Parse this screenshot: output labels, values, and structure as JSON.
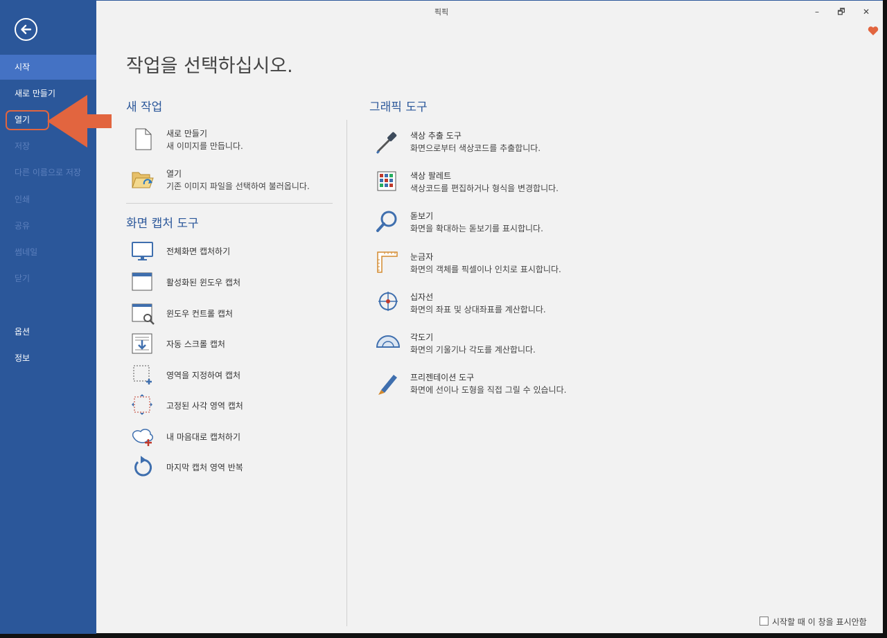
{
  "window": {
    "title": "픽픽",
    "minimize_label": "–",
    "restore_label": "🗗",
    "close_label": "✕"
  },
  "sidebar": {
    "items": [
      {
        "label": "시작",
        "state": "active"
      },
      {
        "label": "새로 만들기",
        "state": "normal"
      },
      {
        "label": "열기",
        "state": "normal"
      },
      {
        "label": "저장",
        "state": "disabled"
      },
      {
        "label": "다른 이름으로 저장",
        "state": "disabled"
      },
      {
        "label": "인쇄",
        "state": "disabled"
      },
      {
        "label": "공유",
        "state": "disabled"
      },
      {
        "label": "썸네일",
        "state": "disabled"
      },
      {
        "label": "닫기",
        "state": "disabled"
      },
      {
        "label": "옵션",
        "state": "normal"
      },
      {
        "label": "정보",
        "state": "normal"
      }
    ]
  },
  "main": {
    "title": "작업을 선택하십시오.",
    "new_task": {
      "heading": "새 작업",
      "items": [
        {
          "title": "새로 만들기",
          "desc": "새 이미지를 만듭니다.",
          "icon": "blank-page-icon"
        },
        {
          "title": "열기",
          "desc": "기존 이미지 파일을 선택하여 불러옵니다.",
          "icon": "open-folder-icon"
        }
      ]
    },
    "capture": {
      "heading": "화면 캡처 도구",
      "items": [
        {
          "title": "전체화면 캡처하기",
          "icon": "monitor-icon"
        },
        {
          "title": "활성화된 윈도우 캡처",
          "icon": "active-window-icon"
        },
        {
          "title": "윈도우 컨트롤 캡처",
          "icon": "window-control-icon"
        },
        {
          "title": "자동 스크롤 캡처",
          "icon": "scroll-capture-icon"
        },
        {
          "title": "영역을 지정하여 캡처",
          "icon": "region-capture-icon"
        },
        {
          "title": "고정된 사각 영역 캡처",
          "icon": "fixed-region-icon"
        },
        {
          "title": "내 마음대로 캡처하기",
          "icon": "freehand-capture-icon"
        },
        {
          "title": "마지막 캡처 영역 반복",
          "icon": "repeat-capture-icon"
        }
      ]
    },
    "graphic": {
      "heading": "그래픽 도구",
      "items": [
        {
          "title": "색상 추출 도구",
          "desc": "화면으로부터 색상코드를 추출합니다.",
          "icon": "eyedropper-icon"
        },
        {
          "title": "색상 팔레트",
          "desc": "색상코드를 편집하거나 형식을 변경합니다.",
          "icon": "palette-icon"
        },
        {
          "title": "돋보기",
          "desc": "화면을 확대하는 돋보기를 표시합니다.",
          "icon": "magnifier-icon"
        },
        {
          "title": "눈금자",
          "desc": "화면의 객체를 픽셀이나 인치로 표시합니다.",
          "icon": "ruler-icon"
        },
        {
          "title": "십자선",
          "desc": "화면의 좌표 및 상대좌표를 계산합니다.",
          "icon": "crosshair-icon"
        },
        {
          "title": "각도기",
          "desc": "화면의 기울기나 각도를 계산합니다.",
          "icon": "protractor-icon"
        },
        {
          "title": "프리젠테이션 도구",
          "desc": "화면에 선이나 도형을 직접 그릴 수 있습니다.",
          "icon": "pen-icon"
        }
      ]
    }
  },
  "footer": {
    "checkbox_label": "시작할 때 이 창을 표시안함",
    "checked": false
  },
  "colors": {
    "sidebar_bg": "#2b579a",
    "sidebar_active": "#4472c4",
    "heading": "#2b579a",
    "annotation_arrow": "#e2653f"
  }
}
